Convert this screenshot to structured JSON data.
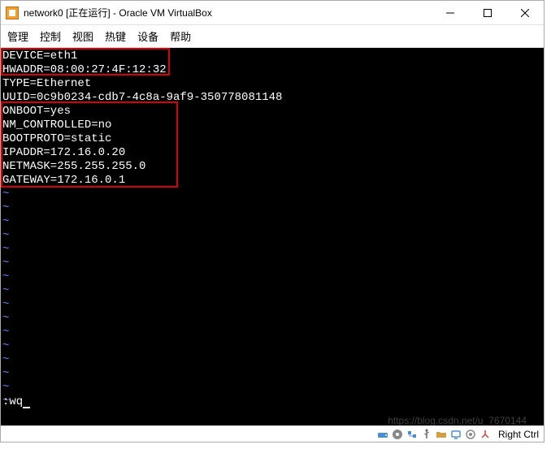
{
  "window": {
    "title": "network0 [正在运行] - Oracle VM VirtualBox"
  },
  "menu": {
    "items": [
      "管理",
      "控制",
      "视图",
      "热键",
      "设备",
      "帮助"
    ]
  },
  "terminal": {
    "lines": [
      "DEVICE=eth1",
      "HWADDR=08:00:27:4F:12:32",
      "TYPE=Ethernet",
      "UUID=0c9b0234-cdb7-4c8a-9af9-350778081148",
      "ONBOOT=yes",
      "NM_CONTROLLED=no",
      "BOOTPROTO=static",
      "IPADDR=172.16.0.20",
      "NETMASK=255.255.255.0",
      "GATEWAY=172.16.0.1"
    ],
    "command": ":wq"
  },
  "statusbar": {
    "modifier": "Right Ctrl"
  },
  "watermark": "https://blog.csdn.net/u_7670144"
}
